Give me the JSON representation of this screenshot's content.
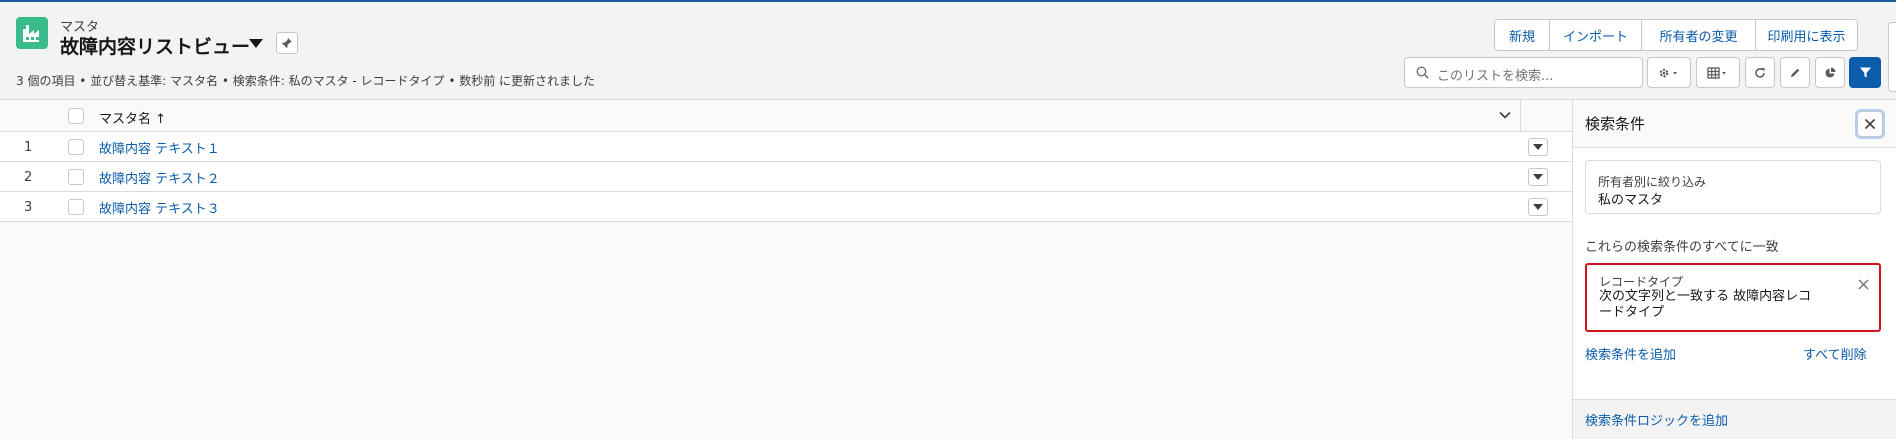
{
  "header": {
    "object_label": "マスタ",
    "list_title": "故障内容リストビュー",
    "meta_line": "3 個の項目 • 並び替え基準: マスタ名 • 検索条件: 私のマスタ - レコードタイプ • 数秒前 に更新されました",
    "buttons": [
      {
        "label": "新規"
      },
      {
        "label": "インポート"
      },
      {
        "label": "所有者の変更"
      },
      {
        "label": "印刷用に表示"
      }
    ],
    "search": {
      "placeholder": "このリストを検索..."
    }
  },
  "table": {
    "columns": [
      {
        "label": "マスタ名 ↑"
      }
    ],
    "rows": [
      {
        "num": "1",
        "name": "故障内容 テキスト１"
      },
      {
        "num": "2",
        "name": "故障内容 テキスト２"
      },
      {
        "num": "3",
        "name": "故障内容 テキスト３"
      }
    ]
  },
  "filter_panel": {
    "title": "検索条件",
    "owner_filter": {
      "label": "所有者別に絞り込み",
      "value": "私のマスタ"
    },
    "match_text": "これらの検索条件のすべてに一致",
    "record_type_filter": {
      "label": "レコードタイプ",
      "value": "次の文字列と一致する 故障内容レコードタイプ"
    },
    "add_filter": "検索条件を追加",
    "remove_all": "すべて削除",
    "add_logic": "検索条件ロジックを追加"
  },
  "colors": {
    "brand": "#0b5cab",
    "app_icon": "#3bba8c",
    "highlight": "#d1141c"
  }
}
